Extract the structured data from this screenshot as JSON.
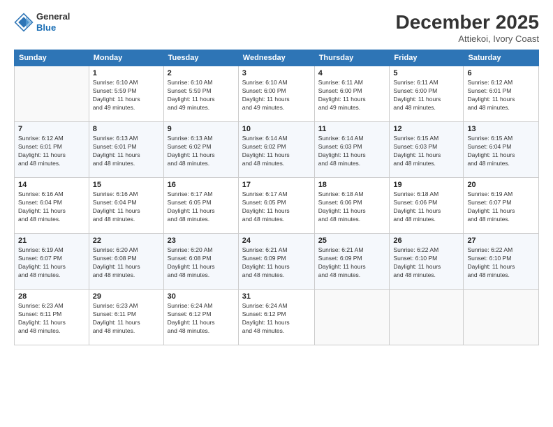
{
  "logo": {
    "line1": "General",
    "line2": "Blue",
    "icon_color": "#2e75b6"
  },
  "title": "December 2025",
  "subtitle": "Attiekoi, Ivory Coast",
  "header_days": [
    "Sunday",
    "Monday",
    "Tuesday",
    "Wednesday",
    "Thursday",
    "Friday",
    "Saturday"
  ],
  "weeks": [
    [
      {
        "day": "",
        "info": ""
      },
      {
        "day": "1",
        "info": "Sunrise: 6:10 AM\nSunset: 5:59 PM\nDaylight: 11 hours\nand 49 minutes."
      },
      {
        "day": "2",
        "info": "Sunrise: 6:10 AM\nSunset: 5:59 PM\nDaylight: 11 hours\nand 49 minutes."
      },
      {
        "day": "3",
        "info": "Sunrise: 6:10 AM\nSunset: 6:00 PM\nDaylight: 11 hours\nand 49 minutes."
      },
      {
        "day": "4",
        "info": "Sunrise: 6:11 AM\nSunset: 6:00 PM\nDaylight: 11 hours\nand 49 minutes."
      },
      {
        "day": "5",
        "info": "Sunrise: 6:11 AM\nSunset: 6:00 PM\nDaylight: 11 hours\nand 48 minutes."
      },
      {
        "day": "6",
        "info": "Sunrise: 6:12 AM\nSunset: 6:01 PM\nDaylight: 11 hours\nand 48 minutes."
      }
    ],
    [
      {
        "day": "7",
        "info": "Sunrise: 6:12 AM\nSunset: 6:01 PM\nDaylight: 11 hours\nand 48 minutes."
      },
      {
        "day": "8",
        "info": "Sunrise: 6:13 AM\nSunset: 6:01 PM\nDaylight: 11 hours\nand 48 minutes."
      },
      {
        "day": "9",
        "info": "Sunrise: 6:13 AM\nSunset: 6:02 PM\nDaylight: 11 hours\nand 48 minutes."
      },
      {
        "day": "10",
        "info": "Sunrise: 6:14 AM\nSunset: 6:02 PM\nDaylight: 11 hours\nand 48 minutes."
      },
      {
        "day": "11",
        "info": "Sunrise: 6:14 AM\nSunset: 6:03 PM\nDaylight: 11 hours\nand 48 minutes."
      },
      {
        "day": "12",
        "info": "Sunrise: 6:15 AM\nSunset: 6:03 PM\nDaylight: 11 hours\nand 48 minutes."
      },
      {
        "day": "13",
        "info": "Sunrise: 6:15 AM\nSunset: 6:04 PM\nDaylight: 11 hours\nand 48 minutes."
      }
    ],
    [
      {
        "day": "14",
        "info": "Sunrise: 6:16 AM\nSunset: 6:04 PM\nDaylight: 11 hours\nand 48 minutes."
      },
      {
        "day": "15",
        "info": "Sunrise: 6:16 AM\nSunset: 6:04 PM\nDaylight: 11 hours\nand 48 minutes."
      },
      {
        "day": "16",
        "info": "Sunrise: 6:17 AM\nSunset: 6:05 PM\nDaylight: 11 hours\nand 48 minutes."
      },
      {
        "day": "17",
        "info": "Sunrise: 6:17 AM\nSunset: 6:05 PM\nDaylight: 11 hours\nand 48 minutes."
      },
      {
        "day": "18",
        "info": "Sunrise: 6:18 AM\nSunset: 6:06 PM\nDaylight: 11 hours\nand 48 minutes."
      },
      {
        "day": "19",
        "info": "Sunrise: 6:18 AM\nSunset: 6:06 PM\nDaylight: 11 hours\nand 48 minutes."
      },
      {
        "day": "20",
        "info": "Sunrise: 6:19 AM\nSunset: 6:07 PM\nDaylight: 11 hours\nand 48 minutes."
      }
    ],
    [
      {
        "day": "21",
        "info": "Sunrise: 6:19 AM\nSunset: 6:07 PM\nDaylight: 11 hours\nand 48 minutes."
      },
      {
        "day": "22",
        "info": "Sunrise: 6:20 AM\nSunset: 6:08 PM\nDaylight: 11 hours\nand 48 minutes."
      },
      {
        "day": "23",
        "info": "Sunrise: 6:20 AM\nSunset: 6:08 PM\nDaylight: 11 hours\nand 48 minutes."
      },
      {
        "day": "24",
        "info": "Sunrise: 6:21 AM\nSunset: 6:09 PM\nDaylight: 11 hours\nand 48 minutes."
      },
      {
        "day": "25",
        "info": "Sunrise: 6:21 AM\nSunset: 6:09 PM\nDaylight: 11 hours\nand 48 minutes."
      },
      {
        "day": "26",
        "info": "Sunrise: 6:22 AM\nSunset: 6:10 PM\nDaylight: 11 hours\nand 48 minutes."
      },
      {
        "day": "27",
        "info": "Sunrise: 6:22 AM\nSunset: 6:10 PM\nDaylight: 11 hours\nand 48 minutes."
      }
    ],
    [
      {
        "day": "28",
        "info": "Sunrise: 6:23 AM\nSunset: 6:11 PM\nDaylight: 11 hours\nand 48 minutes."
      },
      {
        "day": "29",
        "info": "Sunrise: 6:23 AM\nSunset: 6:11 PM\nDaylight: 11 hours\nand 48 minutes."
      },
      {
        "day": "30",
        "info": "Sunrise: 6:24 AM\nSunset: 6:12 PM\nDaylight: 11 hours\nand 48 minutes."
      },
      {
        "day": "31",
        "info": "Sunrise: 6:24 AM\nSunset: 6:12 PM\nDaylight: 11 hours\nand 48 minutes."
      },
      {
        "day": "",
        "info": ""
      },
      {
        "day": "",
        "info": ""
      },
      {
        "day": "",
        "info": ""
      }
    ]
  ]
}
